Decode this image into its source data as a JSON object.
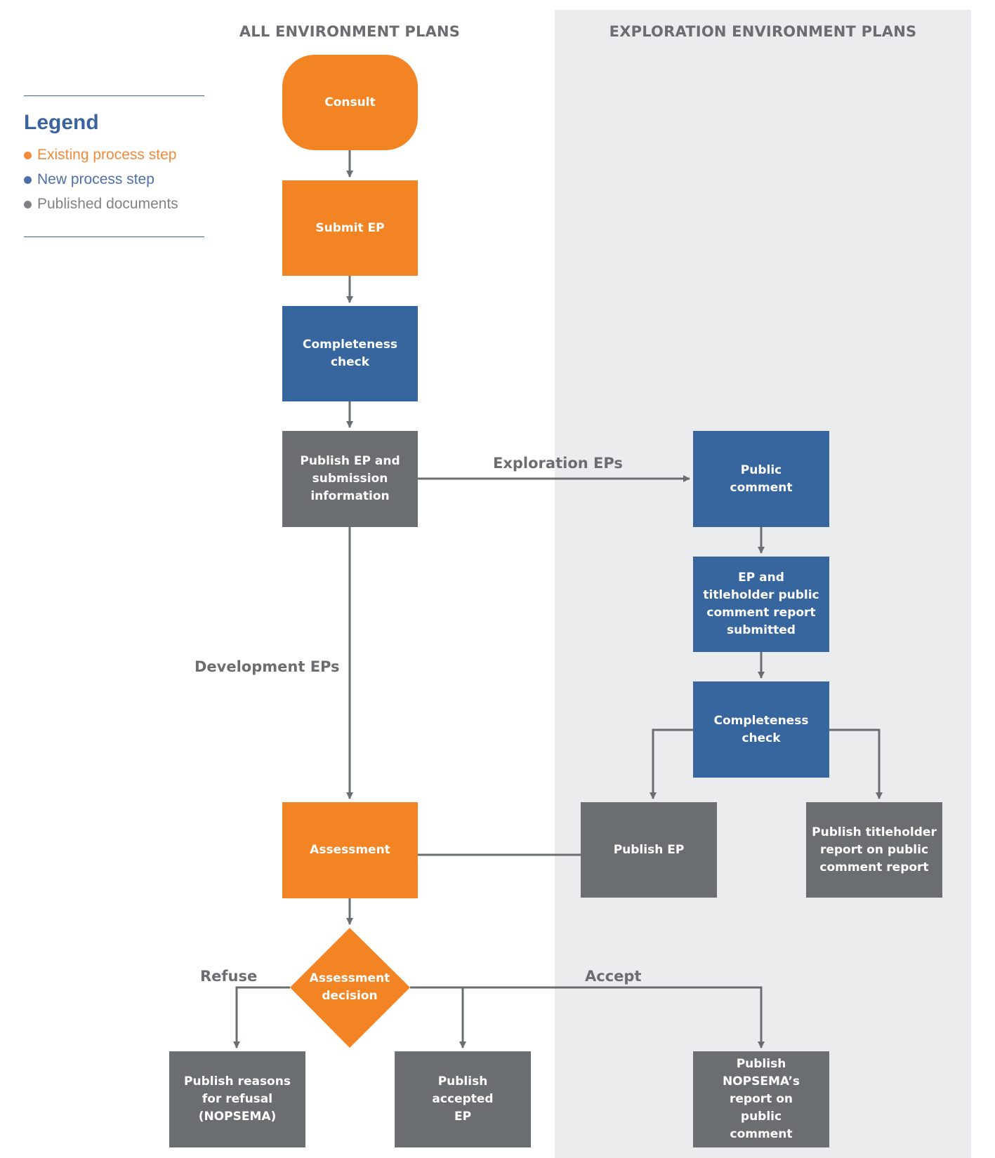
{
  "columns": {
    "left_title": "ALL ENVIRONMENT PLANS",
    "right_title": "EXPLORATION ENVIRONMENT PLANS"
  },
  "legend": {
    "title": "Legend",
    "items": [
      {
        "label": "Existing process step",
        "color": "#f28a3c"
      },
      {
        "label": "New process step",
        "color": "#4f6fa8"
      },
      {
        "label": "Published documents",
        "color": "#808285"
      }
    ]
  },
  "colors": {
    "existing": "#f28424",
    "new": "#37659d",
    "published": "#6b6e71",
    "connector": "#6b6e71",
    "panel": "#ebecee"
  },
  "nodes": {
    "consult": {
      "label": "Consult",
      "type": "existing"
    },
    "submit_ep": {
      "label": "Submit EP",
      "type": "existing"
    },
    "completeness_check": {
      "label": "Completeness check",
      "type": "new"
    },
    "publish_ep_submission": {
      "label": "Publish EP and submission information",
      "type": "published"
    },
    "public_comment": {
      "label": "Public comment",
      "type": "new"
    },
    "ep_titleholder_report": {
      "label": "EP and titleholder public comment report submitted",
      "type": "new"
    },
    "completeness_check_exploration": {
      "label": "Completeness check",
      "type": "new"
    },
    "publish_ep": {
      "label": "Publish EP",
      "type": "published"
    },
    "publish_titleholder_report": {
      "label": "Publish titleholder report on public comment report",
      "type": "published"
    },
    "assessment": {
      "label": "Assessment",
      "type": "existing"
    },
    "assessment_decision": {
      "label": "Assessment decision",
      "type": "existing"
    },
    "publish_refusal_reasons": {
      "label": "Publish reasons for refusal (NOPSEMA)",
      "type": "published"
    },
    "publish_accepted_ep": {
      "label": "Publish accepted EP",
      "type": "published"
    },
    "publish_nopsema_report": {
      "label": "Publish NOPSEMA’s report on public comment",
      "type": "published"
    }
  },
  "edge_labels": {
    "exploration": "Exploration EPs",
    "development": "Development EPs",
    "refuse": "Refuse",
    "accept": "Accept"
  }
}
